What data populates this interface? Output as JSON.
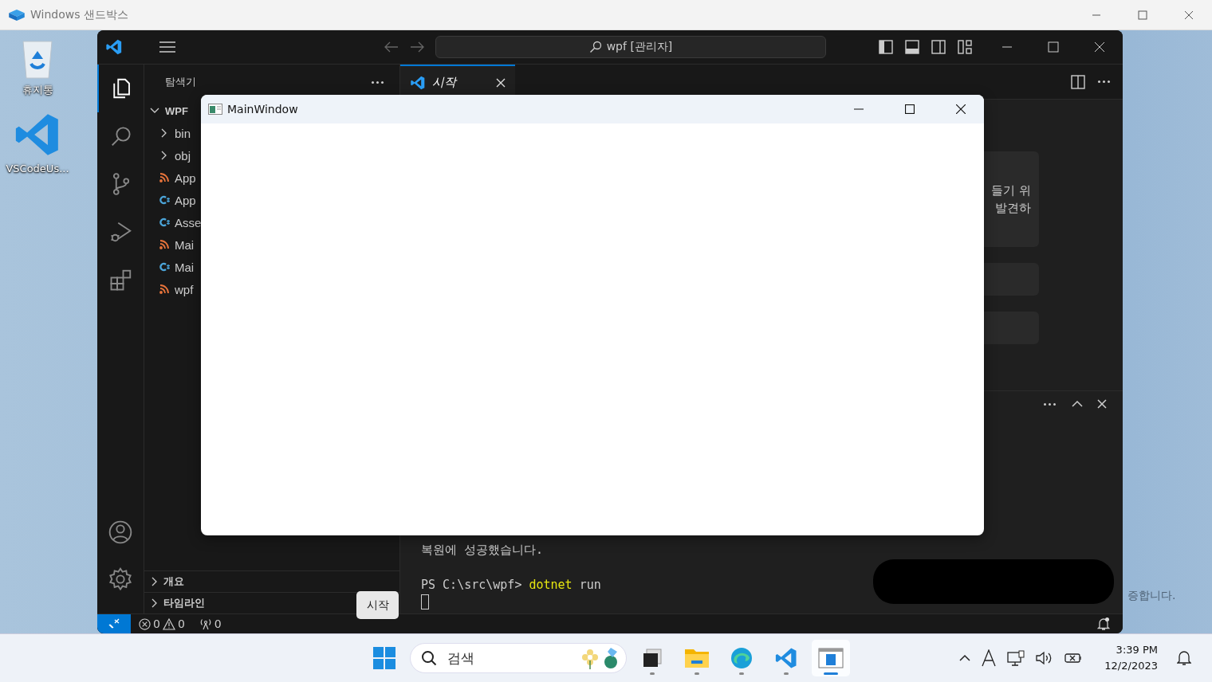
{
  "sandbox_window": {
    "title": "Windows 샌드박스"
  },
  "desktop_icons": [
    {
      "label": "휴지통",
      "kind": "recycle"
    },
    {
      "label": "VSCodeUs...",
      "kind": "vscode"
    }
  ],
  "vscode": {
    "command_center": "wpf [관리자]",
    "activity": [
      {
        "kind": "explorer",
        "selected": true
      },
      {
        "kind": "search",
        "selected": false
      },
      {
        "kind": "git",
        "selected": false
      },
      {
        "kind": "debug",
        "selected": false
      },
      {
        "kind": "extensions",
        "selected": false
      }
    ],
    "explorer": {
      "title": "탐색기",
      "root": {
        "label": "WPF",
        "expanded": true,
        "children": [
          {
            "label": "bin",
            "kind": "folder",
            "expanded": false
          },
          {
            "label": "obj",
            "kind": "folder",
            "expanded": false
          },
          {
            "label": "App",
            "kind": "xaml"
          },
          {
            "label": "App",
            "kind": "csharp"
          },
          {
            "label": "Asse",
            "kind": "csharp"
          },
          {
            "label": "Mai",
            "kind": "xaml"
          },
          {
            "label": "Mai",
            "kind": "csharp"
          },
          {
            "label": "wpf",
            "kind": "xaml"
          }
        ]
      }
    },
    "sections": [
      {
        "label": "개요",
        "expanded": false
      },
      {
        "label": "타임라인",
        "expanded": false
      }
    ],
    "tabs": [
      {
        "label": "시작",
        "selected": true
      }
    ],
    "welcome_fragments": [
      "들기 위",
      "발견하"
    ],
    "terminal": {
      "message": "복원에 성공했습니다.",
      "prompt": "PS C:\\src\\wpf>",
      "command": "dotnet",
      "args": "run",
      "overflow_text": "증합니다."
    },
    "tooltip": "시작",
    "status": {
      "errors": "0",
      "warnings": "0",
      "ports": "0"
    }
  },
  "main_window": {
    "title": "MainWindow"
  },
  "taskbar": {
    "search_placeholder": "검색",
    "apps": [
      {
        "kind": "taskview",
        "selected": false
      },
      {
        "kind": "files",
        "selected": false
      },
      {
        "kind": "edge",
        "selected": false
      },
      {
        "kind": "vscode",
        "selected": false
      },
      {
        "kind": "sandbox",
        "selected": true
      }
    ],
    "time": "3:39 PM",
    "date": "12/2/2023"
  }
}
